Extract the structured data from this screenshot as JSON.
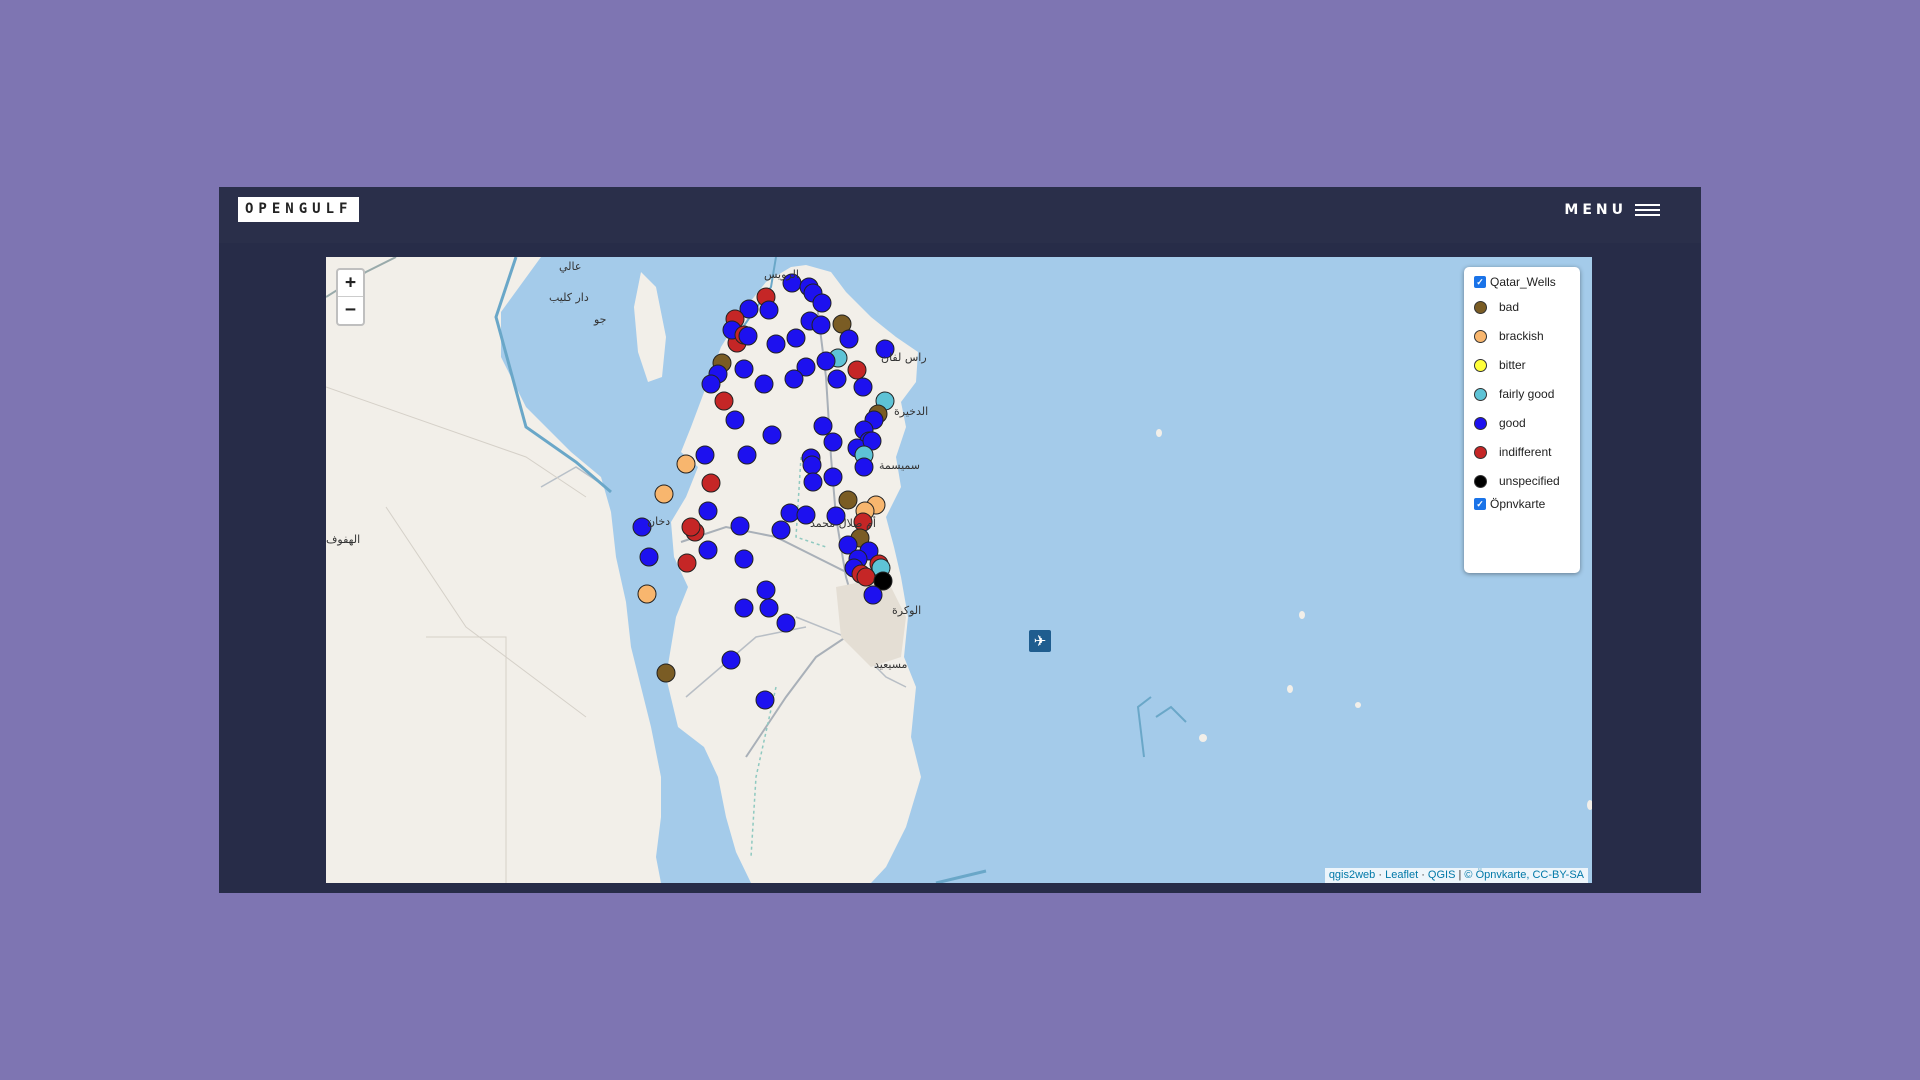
{
  "header": {
    "logo": "OPENGULF",
    "menu_label": "MENU"
  },
  "map": {
    "zoom_in": "+",
    "zoom_out": "−",
    "attribution": {
      "qgis2web": "qgis2web",
      "leaflet": "Leaflet",
      "qgis": "QGIS",
      "osm": "© Öpnvkarte, CC-BY-SA"
    },
    "place_labels": {
      "top_left_1": "عالي",
      "top_left_2": "دار كليب",
      "top_left_3": "جو",
      "top_center": "الرويس",
      "east_1": "راس لفان",
      "east_2": "الدخيرة",
      "east_3": "سميسمة",
      "central": "أم صلال محمد",
      "wakra": "الوكرة",
      "mesaieed": "مسيعيد",
      "west": "دخان",
      "left_edge": "الهفوف"
    }
  },
  "legend": {
    "layer1": "Qatar_Wells",
    "layer2": "Öpnvkarte",
    "categories": [
      {
        "label": "bad",
        "color": "#7a5c24"
      },
      {
        "label": "brackish",
        "color": "#f8b66e"
      },
      {
        "label": "bitter",
        "color": "#ffff3a"
      },
      {
        "label": "fairly good",
        "color": "#5ec3d6"
      },
      {
        "label": "good",
        "color": "#1d11ef"
      },
      {
        "label": "indifferent",
        "color": "#c52626"
      },
      {
        "label": "unspecified",
        "color": "#000000"
      }
    ]
  }
}
